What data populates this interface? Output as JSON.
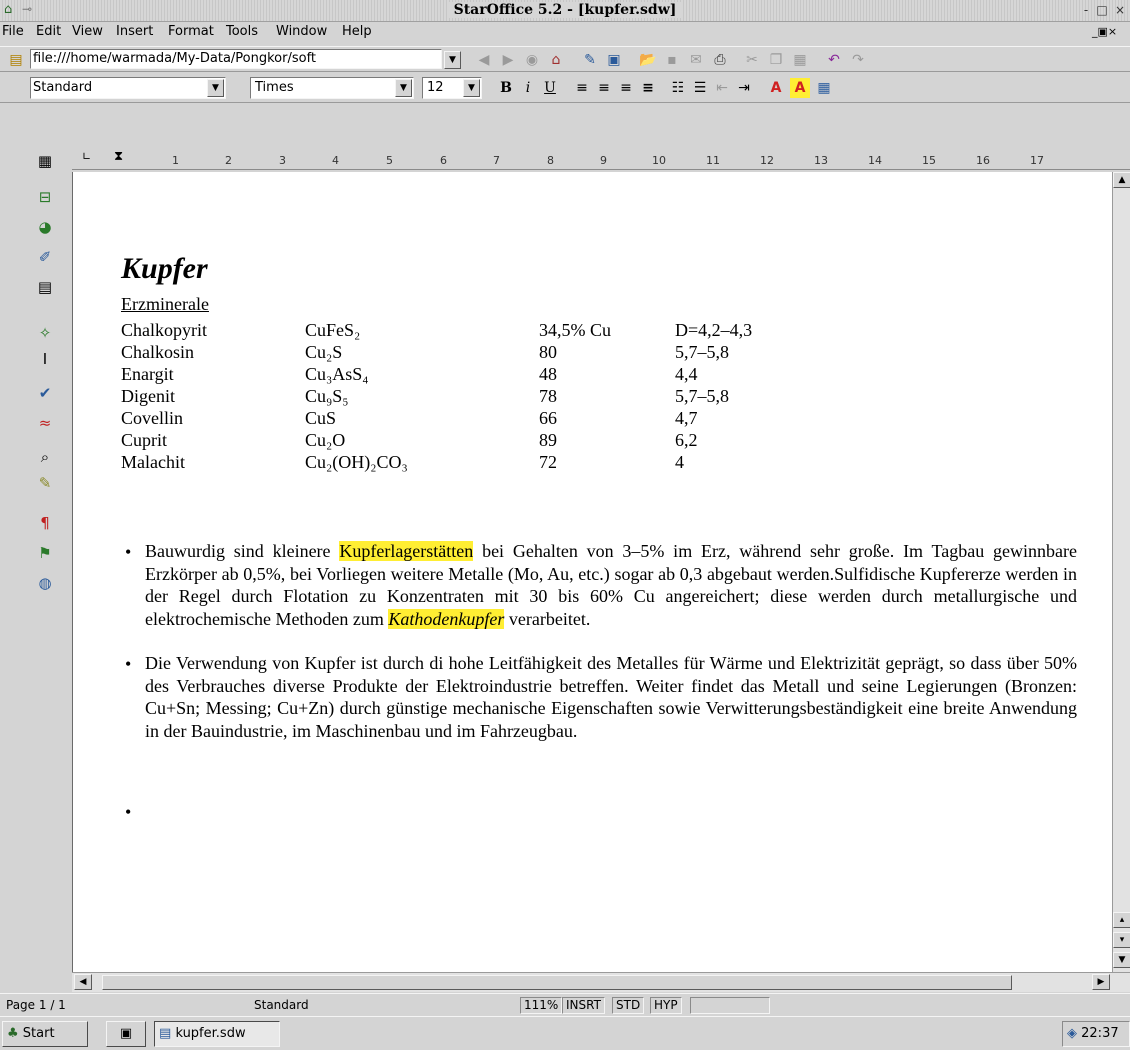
{
  "window": {
    "title": "StarOffice 5.2 - [kupfer.sdw]",
    "buttons": {
      "minimize": "-",
      "maximize": "□",
      "close": "×"
    }
  },
  "menu": {
    "items": [
      {
        "label": "File"
      },
      {
        "label": "Edit"
      },
      {
        "label": "View"
      },
      {
        "label": "Insert"
      },
      {
        "label": "Format"
      },
      {
        "label": "Tools"
      },
      {
        "label": "Window"
      },
      {
        "label": "Help"
      }
    ]
  },
  "urlbar": {
    "url": "file:///home/warmada/My-Data/Pongkor/soft"
  },
  "format": {
    "style": "Standard",
    "font": "Times",
    "size": "12"
  },
  "ruler": {
    "marks": [
      "1",
      "2",
      "3",
      "4",
      "5",
      "6",
      "7",
      "8",
      "9",
      "10",
      "11",
      "12",
      "13",
      "14",
      "15",
      "16",
      "17"
    ]
  },
  "document": {
    "title": "Kupfer",
    "subtitle": "Erzminerale",
    "minerals": [
      {
        "name": "Chalkopyrit",
        "formula": "CuFeS₂",
        "content": "34,5% Cu",
        "density": "D=4,2–4,3"
      },
      {
        "name": "Chalkosin",
        "formula": "Cu₂S",
        "content": "80",
        "density": "5,7–5,8"
      },
      {
        "name": "Enargit",
        "formula": "Cu₃AsS₄",
        "content": "48",
        "density": "4,4"
      },
      {
        "name": "Digenit",
        "formula": "Cu₉S₅",
        "content": "78",
        "density": "5,7–5,8"
      },
      {
        "name": "Covellin",
        "formula": "CuS",
        "content": "66",
        "density": "4,7"
      },
      {
        "name": "Cuprit",
        "formula": "Cu₂O",
        "content": "89",
        "density": "6,2"
      },
      {
        "name": "Malachit",
        "formula": "Cu₂(OH)₂CO₃",
        "content": "72",
        "density": "4"
      }
    ],
    "bullet1": {
      "before": "Bauwurdig sind kleinere ",
      "highlight1": "Kupferlagerstätten",
      "middle": " bei Gehalten von 3–5% im Erz, während sehr große. Im Tagbau gewinnbare Erzkörper ab 0,5%, bei Vorliegen weitere Metalle (Mo, Au, etc.) sogar ab 0,3 abgebaut werden.Sulfidische Kupfererze werden in der Regel durch Flotation zu Konzentraten mit 30 bis 60% Cu angereichert; diese werden durch metallurgische und elektrochemische Methoden zum ",
      "highlight2": "Kathodenkupfer",
      "after": " verarbeitet."
    },
    "bullet2": "Die Verwendung von Kupfer ist durch di hohe Leitfähigkeit des Metalles für Wärme und Elektrizität geprägt, so dass über 50% des Verbrauches diverse Produkte der Elektroindustrie betreffen. Weiter findet das Metall und seine Legierungen (Bronzen: Cu+Sn; Messing; Cu+Zn) durch günstige mechanische Eigenschaften sowie Verwitterungsbeständigkeit eine breite Anwendung in der Bauindustrie, im Maschinenbau und im Fahrzeugbau.",
    "bullet_char": "•"
  },
  "status": {
    "page": "Page 1 / 1",
    "style": "Standard",
    "zoom": "111%",
    "mode": "INSRT",
    "selection": "STD",
    "hyperlink": "HYP"
  },
  "taskbar": {
    "start": "Start",
    "task": "kupfer.sdw",
    "clock": "22:37"
  },
  "colors": {
    "highlight": "#ffee33",
    "chrome": "#d4d4d4"
  }
}
